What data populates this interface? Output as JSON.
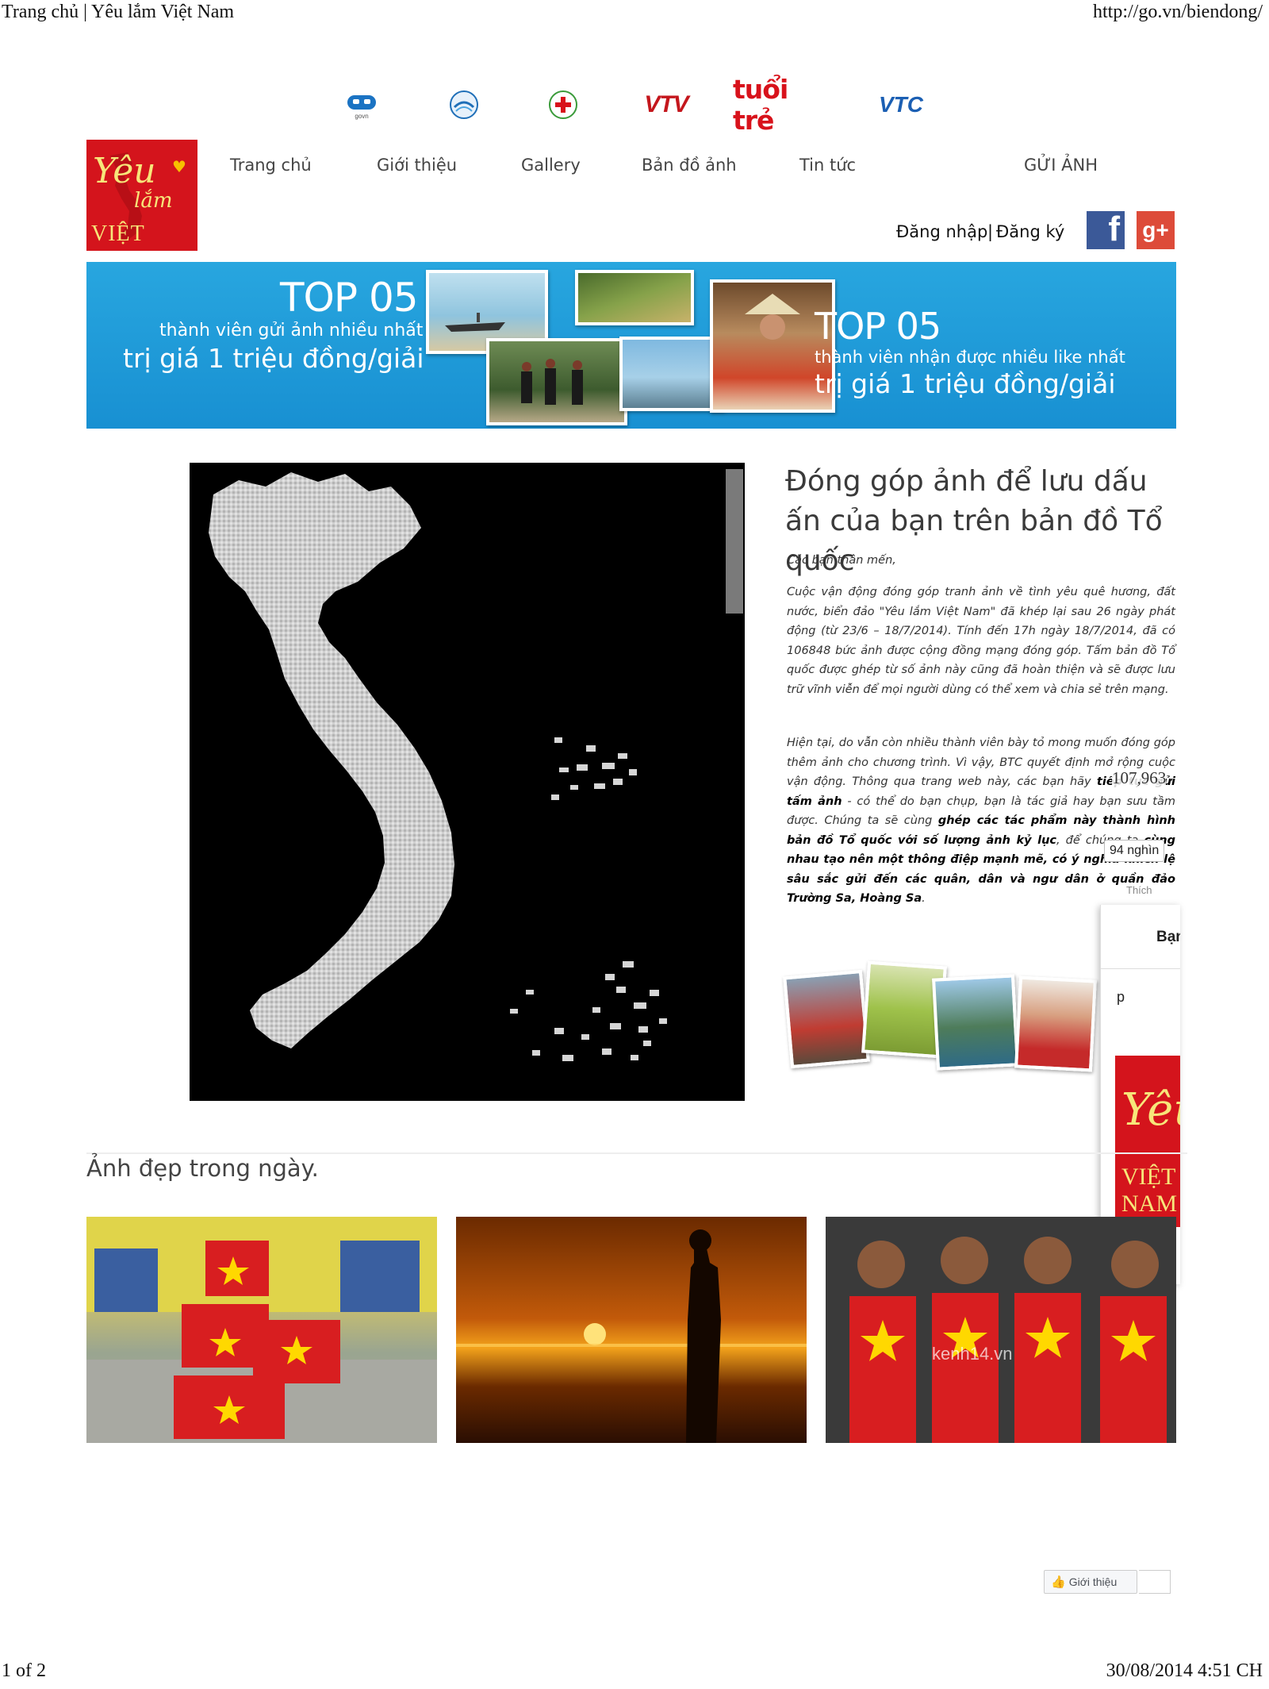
{
  "print": {
    "header_left": "Trang chủ | Yêu lắm Việt Nam",
    "header_right": "http://go.vn/biendong/",
    "footer_left": "1 of 2",
    "footer_right": "30/08/2014 4:51 CH"
  },
  "partners": {
    "govn": "govn",
    "vtv": "VTV",
    "tuoitre": "tuổi trẻ",
    "vtc": "VTC"
  },
  "logo": {
    "line1": "Yêu",
    "line2": "lắm",
    "line3": "VIỆT NAM"
  },
  "nav": [
    "Trang chủ",
    "Giới thiệu",
    "Gallery",
    "Bản đồ ảnh",
    "Tin tức",
    "GỬI ẢNH"
  ],
  "auth": {
    "login": "Đăng nhập",
    "separator": "|",
    "register": "Đăng ký"
  },
  "social": {
    "facebook": "f",
    "google": "g+"
  },
  "banner": {
    "left_top": "TOP 05",
    "left_mid": "thành viên gửi ảnh nhiều nhất",
    "left_bottom": "trị giá 1 triệu đồng/giải",
    "right_top": "TOP 05",
    "right_mid": "thành viên nhận được nhiều like nhất",
    "right_bottom": "trị giá 1 triệu đồng/giải"
  },
  "article": {
    "title": "Đóng góp ảnh để lưu dấu ấn của bạn trên bản đồ Tổ quốc",
    "greeting": "Các bạn thân mến,",
    "para1": "Cuộc vận động đóng góp tranh ảnh về tình yêu quê hương, đất nước, biển đảo \"Yêu lắm Việt Nam\" đã khép lại sau 26 ngày phát động (từ 23/6 – 18/7/2014). Tính đến 17h ngày 18/7/2014, đã có 106848 bức ảnh được cộng đồng mạng đóng góp. Tấm bản đồ Tổ quốc được ghép từ số ảnh này cũng đã hoàn thiện và sẽ được lưu trữ vĩnh viễn để mọi người dùng có thể xem và chia sẻ trên mạng.",
    "p2_a": "Hiện tại, do vẫn còn nhiều thành viên bày tỏ mong muốn đóng góp thêm ảnh cho chương trình. Vì vậy, BTC quyết định mở rộng cuộc vận động. Thông qua trang web này, các bạn hãy ",
    "p2_b": "tiếp tục gửi tấm ảnh",
    "p2_c": " - có thể do bạn chụp, bạn là tác giả hay bạn sưu tầm được. Chúng ta sẽ cùng ",
    "p2_d": "ghép các tác phẩm này thành hình bản đồ Tổ quốc với số lượng ảnh kỷ lục",
    "p2_e": ", để chúng ta ",
    "p2_f": "cùng nhau tạo nên một thông điệp mạnh mẽ, có ý nghĩa khích lệ sâu sắc gửi đến các quân, dân và ngư dân ở quần đảo Trường Sa, Hoàng Sa",
    "p2_g": "."
  },
  "counters": {
    "share_count": "107,963",
    "like_count": "94 nghìn",
    "like_label": "Thích"
  },
  "fb_popup": {
    "title": "Bạn",
    "field": "p"
  },
  "section_title": "Ảnh đẹp trong ngày.",
  "watermark": "kenh14.vn",
  "fb_button": "Giới thiệu"
}
